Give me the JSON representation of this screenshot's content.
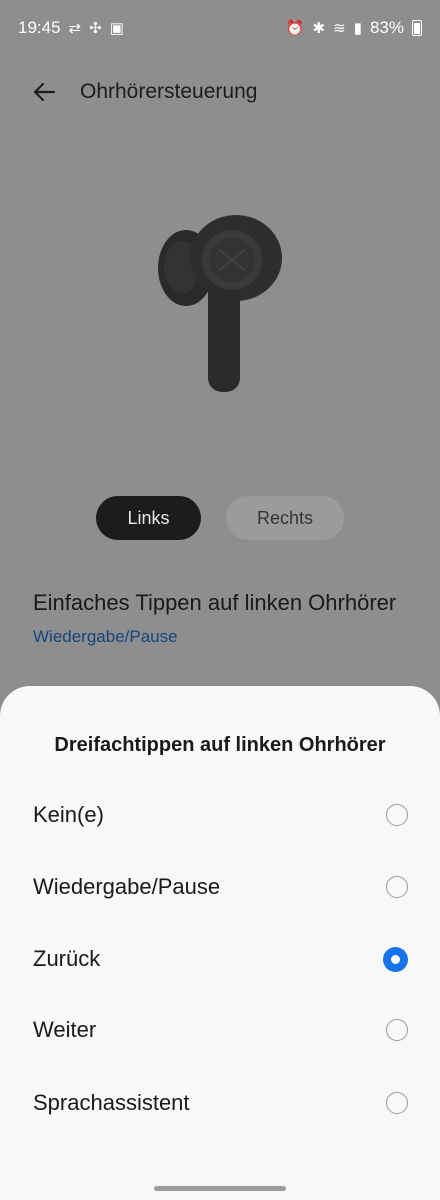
{
  "status_bar": {
    "time": "19:45",
    "battery": "83%",
    "left_icons": [
      "data-transfer-icon",
      "fan-icon",
      "image-icon"
    ],
    "right_icons": [
      "alarm-icon",
      "bluetooth-icon",
      "wifi-icon",
      "signal-icon",
      "battery-icon"
    ]
  },
  "header": {
    "title": "Ohrhörersteuerung",
    "back_icon": "arrow-left-icon"
  },
  "tabs": {
    "left": "Links",
    "right": "Rechts",
    "selected": "Links"
  },
  "setting": {
    "title": "Einfaches Tippen auf linken Ohrhörer",
    "value": "Wiedergabe/Pause"
  },
  "sheet": {
    "title": "Dreifachtippen auf linken Ohrhörer",
    "options": [
      {
        "label": "Kein(e)",
        "selected": false
      },
      {
        "label": "Wiedergabe/Pause",
        "selected": false
      },
      {
        "label": "Zurück",
        "selected": true
      },
      {
        "label": "Weiter",
        "selected": false
      },
      {
        "label": "Sprachassistent",
        "selected": false
      }
    ]
  },
  "colors": {
    "accent": "#1773e8",
    "link": "#14457f",
    "scrim": "#8e8e8e"
  }
}
